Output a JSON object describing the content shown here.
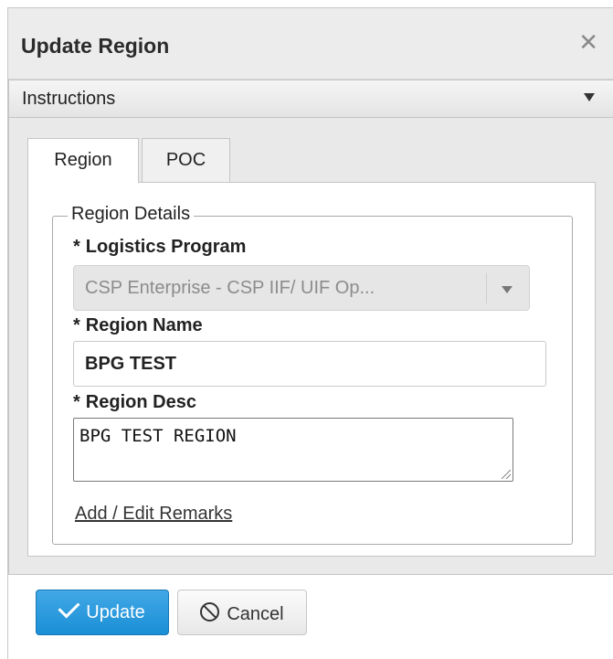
{
  "dialog": {
    "title": "Update Region",
    "close_icon": "close-icon"
  },
  "instructions": {
    "label": "Instructions",
    "icon": "chevron-down-icon"
  },
  "tabs": [
    {
      "label": "Region",
      "active": true
    },
    {
      "label": "POC",
      "active": false
    }
  ],
  "region_details": {
    "legend": "Region Details",
    "required_marker": "*",
    "logistics_program": {
      "label": "Logistics Program",
      "value": "CSP Enterprise - CSP IIF/ UIF Op...",
      "disabled": true
    },
    "region_name": {
      "label": "Region Name",
      "value": "BPG TEST"
    },
    "region_desc": {
      "label": "Region Desc",
      "value": "BPG TEST REGION"
    },
    "remarks_link": "Add / Edit Remarks"
  },
  "buttons": {
    "update": "Update",
    "cancel": "Cancel"
  },
  "colors": {
    "primary_button": "#1a8fd6",
    "titlebar": "#ececec"
  }
}
